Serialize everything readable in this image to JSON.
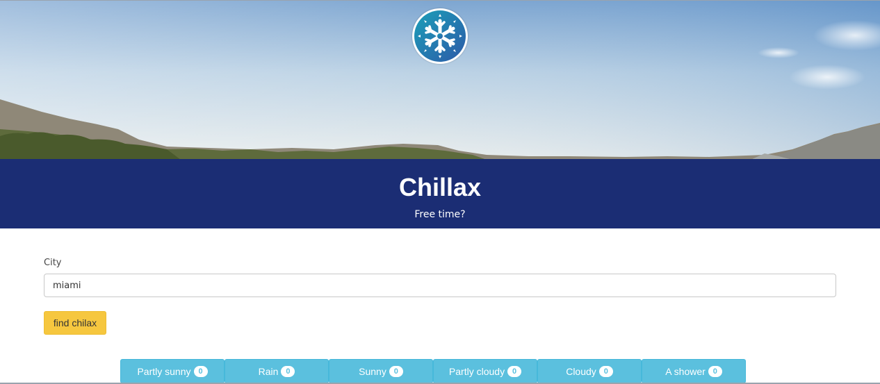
{
  "header": {
    "logo_icon": "snowflake-icon",
    "title": "Chillax",
    "subtitle": "Free time?"
  },
  "form": {
    "city_label": "City",
    "city_value": "miami",
    "submit_label": "find chilax"
  },
  "conditions": [
    {
      "label": "Partly sunny",
      "count": "0"
    },
    {
      "label": "Rain",
      "count": "0"
    },
    {
      "label": "Sunny",
      "count": "0"
    },
    {
      "label": "Partly cloudy",
      "count": "0"
    },
    {
      "label": "Cloudy",
      "count": "0"
    },
    {
      "label": "A shower",
      "count": "0"
    }
  ],
  "colors": {
    "banner": "#1b2d74",
    "submit": "#f6c73f",
    "tab": "#5bc0de",
    "logo_gradient": [
      "#1c9fb8",
      "#2c5aa8"
    ]
  }
}
